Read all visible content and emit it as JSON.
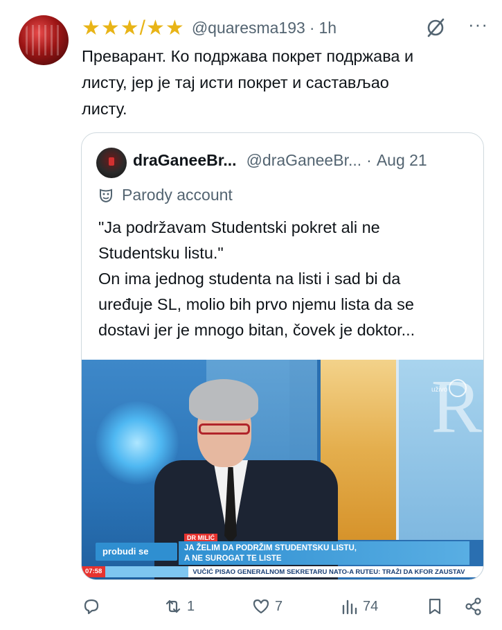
{
  "tweet": {
    "author_name": "★★★/★★",
    "handle": "@quaresma193",
    "separator": "·",
    "time": "1h",
    "more_label": "···",
    "text_line1": "Преварант. Ко подржава покрет подржава и",
    "text_line2": "листу, јер је тај исти покрет и састављао",
    "text_line3": "листу."
  },
  "quote": {
    "name": "draGaneeBr...",
    "handle": "@draGaneeBr...",
    "separator": "·",
    "date": "Aug 21",
    "parody_label": "Parody account",
    "line1": "\"Ja podržavam Studentski pokret ali ne",
    "line2": "Studentsku listu.\"",
    "line3": "On ima jednog studenta na listi i sad bi da",
    "line4": "uređuje SL, molio bih prvo njemu lista da se",
    "line5": "dostavi jer je mnogo bitan, čovek je doktor..."
  },
  "media": {
    "name_tag": "DR MILIĆ",
    "brand": "probudi se",
    "headline_line1": "JA ŽELIM DA PODRŽIM STUDENTSKU LISTU,",
    "headline_line2": "A NE SUROGAT TE LISTE",
    "ticker_time": "07:58",
    "ticker_text": "VUČIĆ PISAO GENERALNOM SEKRETARU NATO-A RUTEU: TRAŽI DA KFOR ZAUSTAV",
    "live_label": "uživo"
  },
  "actions": {
    "replies": "",
    "retweets": "1",
    "likes": "7",
    "views": "74"
  },
  "colors": {
    "text": "#0f1419",
    "secondary": "#536471",
    "border": "#cfd9de",
    "stars": "#e8b417"
  }
}
